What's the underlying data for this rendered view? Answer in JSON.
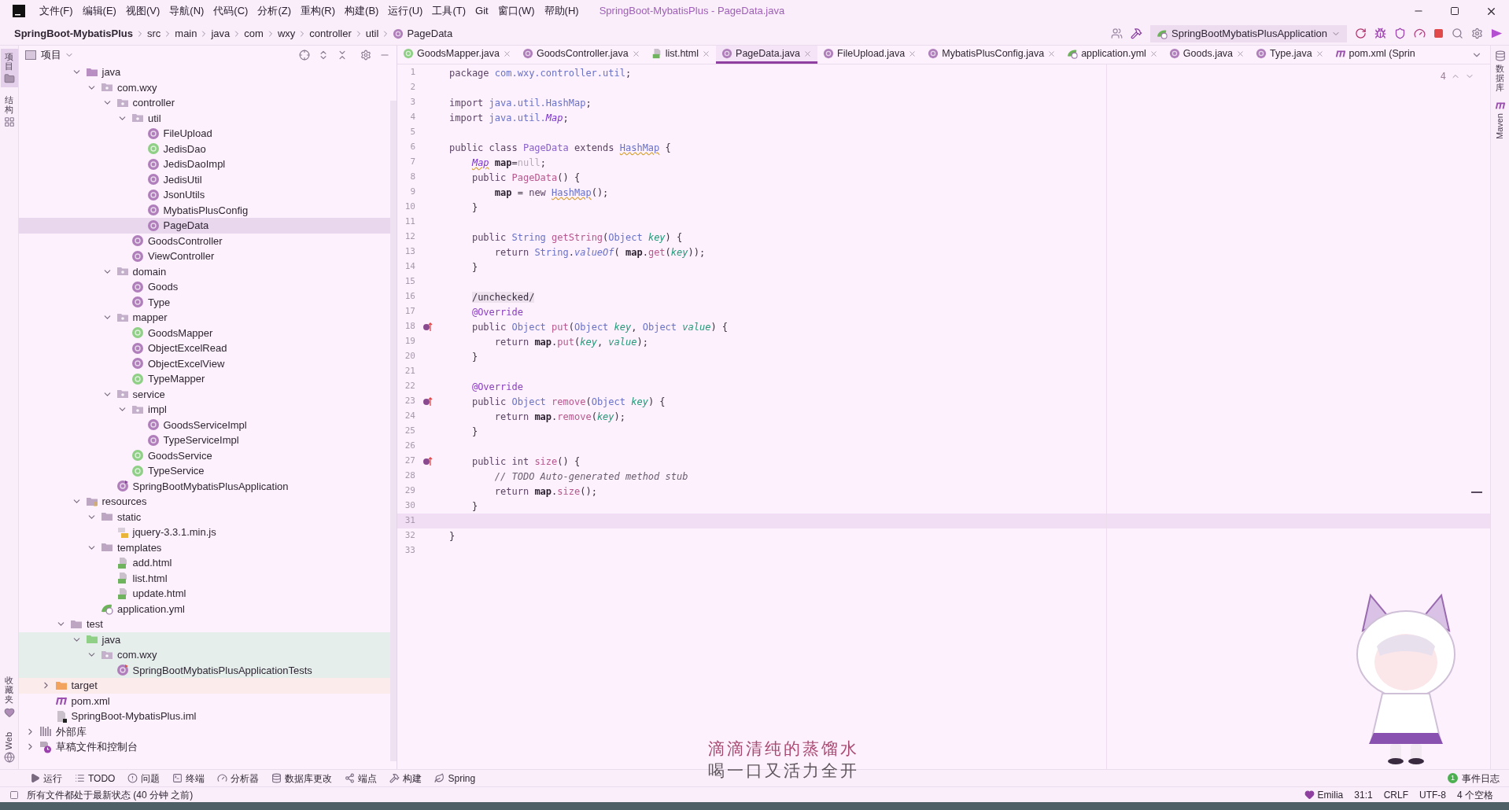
{
  "menu": [
    "文件(F)",
    "编辑(E)",
    "视图(V)",
    "导航(N)",
    "代码(C)",
    "分析(Z)",
    "重构(R)",
    "构建(B)",
    "运行(U)",
    "工具(T)",
    "Git",
    "窗口(W)",
    "帮助(H)"
  ],
  "window_title": "SpringBoot-MybatisPlus - PageData.java",
  "breadcrumbs": [
    {
      "label": "SpringBoot-MybatisPlus",
      "kind": "project"
    },
    {
      "label": "src",
      "kind": "dir"
    },
    {
      "label": "main",
      "kind": "dir"
    },
    {
      "label": "java",
      "kind": "dir"
    },
    {
      "label": "com",
      "kind": "dir"
    },
    {
      "label": "wxy",
      "kind": "dir"
    },
    {
      "label": "controller",
      "kind": "dir"
    },
    {
      "label": "util",
      "kind": "dir"
    },
    {
      "label": "PageData",
      "kind": "class"
    }
  ],
  "run_config": "SpringBootMybatisPlusApplication",
  "left_strip": {
    "top": [
      {
        "label": "项目",
        "kind": "folder",
        "selected": true
      },
      {
        "label": "结构",
        "kind": "structure",
        "selected": false
      }
    ],
    "bottom": [
      {
        "label": "收藏夹",
        "kind": "heart",
        "selected": false
      },
      {
        "label": "Web",
        "kind": "globe",
        "selected": false
      }
    ]
  },
  "right_strip": [
    {
      "label": "数据库",
      "kind": "database"
    },
    {
      "label": "Maven",
      "kind": "maven"
    }
  ],
  "project_panel": {
    "title": "项目"
  },
  "tree": [
    {
      "children": [
        {
          "children": [
            {
              "children": [
                {
                  "label": "java",
                  "kind": "source-root",
                  "expanded": true,
                  "selected": false,
                  "children": [
                    {
                      "label": "com.wxy",
                      "kind": "package",
                      "expanded": true,
                      "selected": false,
                      "children": [
                        {
                          "label": "controller",
                          "kind": "package",
                          "expanded": true,
                          "selected": false,
                          "children": [
                            {
                              "label": "util",
                              "kind": "package",
                              "expanded": true,
                              "selected": false,
                              "children": [
                                {
                                  "label": "FileUpload",
                                  "kind": "class",
                                  "selected": false
                                },
                                {
                                  "label": "JedisDao",
                                  "kind": "interface",
                                  "selected": false
                                },
                                {
                                  "label": "JedisDaoImpl",
                                  "kind": "class",
                                  "selected": false
                                },
                                {
                                  "label": "JedisUtil",
                                  "kind": "class",
                                  "selected": false
                                },
                                {
                                  "label": "JsonUtils",
                                  "kind": "class",
                                  "selected": false
                                },
                                {
                                  "label": "MybatisPlusConfig",
                                  "kind": "class",
                                  "selected": false
                                },
                                {
                                  "label": "PageData",
                                  "kind": "class",
                                  "selected": true
                                }
                              ]
                            },
                            {
                              "label": "GoodsController",
                              "kind": "class",
                              "selected": false
                            },
                            {
                              "label": "ViewController",
                              "kind": "class",
                              "selected": false
                            }
                          ]
                        },
                        {
                          "label": "domain",
                          "kind": "package",
                          "expanded": true,
                          "selected": false,
                          "children": [
                            {
                              "label": "Goods",
                              "kind": "class",
                              "selected": false
                            },
                            {
                              "label": "Type",
                              "kind": "class",
                              "selected": false
                            }
                          ]
                        },
                        {
                          "label": "mapper",
                          "kind": "package",
                          "expanded": true,
                          "selected": false,
                          "children": [
                            {
                              "label": "GoodsMapper",
                              "kind": "interface",
                              "selected": false
                            },
                            {
                              "label": "ObjectExcelRead",
                              "kind": "class",
                              "selected": false
                            },
                            {
                              "label": "ObjectExcelView",
                              "kind": "class",
                              "selected": false
                            },
                            {
                              "label": "TypeMapper",
                              "kind": "interface",
                              "selected": false
                            }
                          ]
                        },
                        {
                          "label": "service",
                          "kind": "package",
                          "expanded": true,
                          "selected": false,
                          "children": [
                            {
                              "label": "impl",
                              "kind": "package",
                              "expanded": true,
                              "selected": false,
                              "children": [
                                {
                                  "label": "GoodsServiceImpl",
                                  "kind": "class",
                                  "selected": false
                                },
                                {
                                  "label": "TypeServiceImpl",
                                  "kind": "class",
                                  "selected": false
                                }
                              ]
                            },
                            {
                              "label": "GoodsService",
                              "kind": "interface",
                              "selected": false
                            },
                            {
                              "label": "TypeService",
                              "kind": "interface",
                              "selected": false
                            }
                          ]
                        },
                        {
                          "label": "SpringBootMybatisPlusApplication",
                          "kind": "app-class",
                          "selected": false
                        }
                      ]
                    }
                  ]
                },
                {
                  "label": "resources",
                  "kind": "resource-root",
                  "expanded": true,
                  "selected": false,
                  "children": [
                    {
                      "label": "static",
                      "kind": "folder",
                      "expanded": true,
                      "selected": false,
                      "children": [
                        {
                          "label": "jquery-3.3.1.min.js",
                          "kind": "js",
                          "selected": false
                        }
                      ]
                    },
                    {
                      "label": "templates",
                      "kind": "folder",
                      "expanded": true,
                      "selected": false,
                      "children": [
                        {
                          "label": "add.html",
                          "kind": "html",
                          "selected": false
                        },
                        {
                          "label": "list.html",
                          "kind": "html",
                          "selected": false
                        },
                        {
                          "label": "update.html",
                          "kind": "html",
                          "selected": false
                        }
                      ]
                    },
                    {
                      "label": "application.yml",
                      "kind": "yml",
                      "selected": false
                    }
                  ]
                }
              ]
            },
            {
              "label": "test",
              "kind": "folder",
              "expanded": true,
              "selected": false,
              "children": [
                {
                  "label": "java",
                  "kind": "test-root",
                  "expanded": true,
                  "selected": false,
                  "children": [
                    {
                      "label": "com.wxy",
                      "kind": "package",
                      "expanded": true,
                      "selected": false,
                      "children": [
                        {
                          "label": "SpringBootMybatisPlusApplicationTests",
                          "kind": "test-class",
                          "selected": false
                        }
                      ]
                    }
                  ]
                }
              ]
            }
          ]
        },
        {
          "label": "target",
          "kind": "excluded",
          "expanded": false,
          "selected": false
        },
        {
          "label": "pom.xml",
          "kind": "maven",
          "selected": false
        },
        {
          "label": "SpringBoot-MybatisPlus.iml",
          "kind": "iml",
          "selected": false
        }
      ]
    },
    {
      "label": "外部库",
      "kind": "library",
      "expanded": false,
      "selected": false
    },
    {
      "label": "草稿文件和控制台",
      "kind": "scratch",
      "expanded": false,
      "selected": false
    }
  ],
  "tabs": [
    {
      "label": "GoodsMapper.java",
      "kind": "interface",
      "selected": false
    },
    {
      "label": "GoodsController.java",
      "kind": "class",
      "selected": false
    },
    {
      "label": "list.html",
      "kind": "html",
      "selected": false
    },
    {
      "label": "PageData.java",
      "kind": "class",
      "selected": true
    },
    {
      "label": "FileUpload.java",
      "kind": "class",
      "selected": false
    },
    {
      "label": "MybatisPlusConfig.java",
      "kind": "class",
      "selected": false
    },
    {
      "label": "application.yml",
      "kind": "yml",
      "selected": false
    },
    {
      "label": "Goods.java",
      "kind": "class",
      "selected": false
    },
    {
      "label": "Type.java",
      "kind": "class",
      "selected": false
    },
    {
      "label": "pom.xml (Sprin",
      "kind": "maven",
      "selected": false
    }
  ],
  "inspection_count": "4",
  "code": [
    {
      "n": "1",
      "tokens": [
        {
          "kind": "kw",
          "text": "package "
        },
        {
          "kind": "pkg",
          "text": "com.wxy.controller.util"
        },
        {
          "kind": "plain",
          "text": ";"
        }
      ]
    },
    {
      "n": "2"
    },
    {
      "n": "3",
      "tokens": [
        {
          "kind": "kw",
          "text": "import "
        },
        {
          "kind": "pkg",
          "text": "java.util.HashMap"
        },
        {
          "kind": "plain",
          "text": ";"
        }
      ]
    },
    {
      "n": "4",
      "tokens": [
        {
          "kind": "kw",
          "text": "import "
        },
        {
          "kind": "pkg",
          "text": "java.util."
        },
        {
          "kind": "type-i",
          "text": "Map"
        },
        {
          "kind": "plain",
          "text": ";"
        }
      ]
    },
    {
      "n": "5"
    },
    {
      "n": "6",
      "tokens": [
        {
          "kind": "kw",
          "text": "public class "
        },
        {
          "kind": "type",
          "text": "PageData"
        },
        {
          "kind": "kw",
          "text": " extends "
        },
        {
          "kind": "type-warn",
          "text": "HashMap"
        },
        {
          "kind": "plain",
          "text": " {"
        }
      ]
    },
    {
      "n": "7",
      "tokens": [
        {
          "kind": "type-i-warn",
          "text": "    Map"
        },
        {
          "kind": "field",
          "text": " map"
        },
        {
          "kind": "plain",
          "text": "="
        },
        {
          "kind": "null",
          "text": "null"
        },
        {
          "kind": "plain",
          "text": ";"
        }
      ]
    },
    {
      "n": "8",
      "tokens": [
        {
          "kind": "kw",
          "text": "    public "
        },
        {
          "kind": "fn",
          "text": "PageData"
        },
        {
          "kind": "plain",
          "text": "() {"
        }
      ]
    },
    {
      "n": "9",
      "tokens": [
        {
          "kind": "field",
          "text": "        map"
        },
        {
          "kind": "plain",
          "text": " = "
        },
        {
          "kind": "kw",
          "text": "new "
        },
        {
          "kind": "type-warn",
          "text": "HashMap"
        },
        {
          "kind": "plain",
          "text": "();"
        }
      ]
    },
    {
      "n": "10",
      "tokens": [
        {
          "kind": "plain",
          "text": "    }"
        }
      ]
    },
    {
      "n": "11"
    },
    {
      "n": "12",
      "tokens": [
        {
          "kind": "kw",
          "text": "    public "
        },
        {
          "kind": "pkg",
          "text": "String "
        },
        {
          "kind": "fn",
          "text": "getString"
        },
        {
          "kind": "plain",
          "text": "("
        },
        {
          "kind": "pkg",
          "text": "Object "
        },
        {
          "kind": "param",
          "text": "key"
        },
        {
          "kind": "plain",
          "text": ") {"
        }
      ]
    },
    {
      "n": "13",
      "tokens": [
        {
          "kind": "kw",
          "text": "        return "
        },
        {
          "kind": "pkg",
          "text": "String"
        },
        {
          "kind": "plain",
          "text": "."
        },
        {
          "kind": "fn-i",
          "text": "valueOf"
        },
        {
          "kind": "plain",
          "text": "( "
        },
        {
          "kind": "field",
          "text": "map"
        },
        {
          "kind": "plain",
          "text": "."
        },
        {
          "kind": "fn",
          "text": "get"
        },
        {
          "kind": "plain",
          "text": "("
        },
        {
          "kind": "param",
          "text": "key"
        },
        {
          "kind": "plain",
          "text": "));"
        }
      ]
    },
    {
      "n": "14",
      "tokens": [
        {
          "kind": "plain",
          "text": "    }"
        }
      ]
    },
    {
      "n": "15"
    },
    {
      "n": "16",
      "tokens": [
        {
          "kind": "hint",
          "text": "    /unchecked/"
        }
      ]
    },
    {
      "n": "17",
      "tokens": [
        {
          "kind": "anno",
          "text": "    @Override"
        }
      ]
    },
    {
      "n": "18",
      "override": true,
      "tokens": [
        {
          "kind": "kw",
          "text": "    public "
        },
        {
          "kind": "pkg",
          "text": "Object "
        },
        {
          "kind": "fn",
          "text": "put"
        },
        {
          "kind": "plain",
          "text": "("
        },
        {
          "kind": "pkg",
          "text": "Object "
        },
        {
          "kind": "param",
          "text": "key"
        },
        {
          "kind": "plain",
          "text": ", "
        },
        {
          "kind": "pkg",
          "text": "Object "
        },
        {
          "kind": "param",
          "text": "value"
        },
        {
          "kind": "plain",
          "text": ") {"
        }
      ]
    },
    {
      "n": "19",
      "tokens": [
        {
          "kind": "kw",
          "text": "        return "
        },
        {
          "kind": "field",
          "text": "map"
        },
        {
          "kind": "plain",
          "text": "."
        },
        {
          "kind": "fn",
          "text": "put"
        },
        {
          "kind": "plain",
          "text": "("
        },
        {
          "kind": "param",
          "text": "key"
        },
        {
          "kind": "plain",
          "text": ", "
        },
        {
          "kind": "param",
          "text": "value"
        },
        {
          "kind": "plain",
          "text": ");"
        }
      ]
    },
    {
      "n": "20",
      "tokens": [
        {
          "kind": "plain",
          "text": "    }"
        }
      ]
    },
    {
      "n": "21"
    },
    {
      "n": "22",
      "tokens": [
        {
          "kind": "anno",
          "text": "    @Override"
        }
      ]
    },
    {
      "n": "23",
      "override": true,
      "tokens": [
        {
          "kind": "kw",
          "text": "    public "
        },
        {
          "kind": "pkg",
          "text": "Object "
        },
        {
          "kind": "fn",
          "text": "remove"
        },
        {
          "kind": "plain",
          "text": "("
        },
        {
          "kind": "pkg",
          "text": "Object "
        },
        {
          "kind": "param",
          "text": "key"
        },
        {
          "kind": "plain",
          "text": ") {"
        }
      ]
    },
    {
      "n": "24",
      "tokens": [
        {
          "kind": "kw",
          "text": "        return "
        },
        {
          "kind": "field",
          "text": "map"
        },
        {
          "kind": "plain",
          "text": "."
        },
        {
          "kind": "fn",
          "text": "remove"
        },
        {
          "kind": "plain",
          "text": "("
        },
        {
          "kind": "param",
          "text": "key"
        },
        {
          "kind": "plain",
          "text": ");"
        }
      ]
    },
    {
      "n": "25",
      "tokens": [
        {
          "kind": "plain",
          "text": "    }"
        }
      ]
    },
    {
      "n": "26"
    },
    {
      "n": "27",
      "override": true,
      "tokens": [
        {
          "kind": "kw",
          "text": "    public int "
        },
        {
          "kind": "fn",
          "text": "size"
        },
        {
          "kind": "plain",
          "text": "() {"
        }
      ]
    },
    {
      "n": "28",
      "tokens": [
        {
          "kind": "comment",
          "text": "        // TODO Auto-generated method stub"
        }
      ]
    },
    {
      "n": "29",
      "tokens": [
        {
          "kind": "kw",
          "text": "        return "
        },
        {
          "kind": "field",
          "text": "map"
        },
        {
          "kind": "plain",
          "text": "."
        },
        {
          "kind": "fn",
          "text": "size"
        },
        {
          "kind": "plain",
          "text": "();"
        }
      ]
    },
    {
      "n": "30",
      "tokens": [
        {
          "kind": "plain",
          "text": "    }"
        }
      ]
    },
    {
      "n": "31",
      "current": true
    },
    {
      "n": "32",
      "tokens": [
        {
          "kind": "plain",
          "text": "}"
        }
      ]
    },
    {
      "n": "33"
    }
  ],
  "overlay_caption": [
    "滴滴清纯的蒸馏水",
    "喝一口又活力全开"
  ],
  "tool_windows": [
    {
      "label": "运行",
      "kind": "run"
    },
    {
      "label": "TODO",
      "kind": "todo"
    },
    {
      "label": "问题",
      "kind": "problems"
    },
    {
      "label": "终端",
      "kind": "terminal"
    },
    {
      "label": "分析器",
      "kind": "profiler"
    },
    {
      "label": "数据库更改",
      "kind": "database"
    },
    {
      "label": "端点",
      "kind": "endpoints"
    },
    {
      "label": "构建",
      "kind": "build"
    },
    {
      "label": "Spring",
      "kind": "spring"
    }
  ],
  "event_log": {
    "label": "事件日志",
    "count": "1"
  },
  "status": {
    "message": "所有文件都处于最新状态 (40 分钟 之前)",
    "theme": "Emilia",
    "items": [
      "31:1",
      "CRLF",
      "UTF-8",
      "4 个空格"
    ]
  }
}
